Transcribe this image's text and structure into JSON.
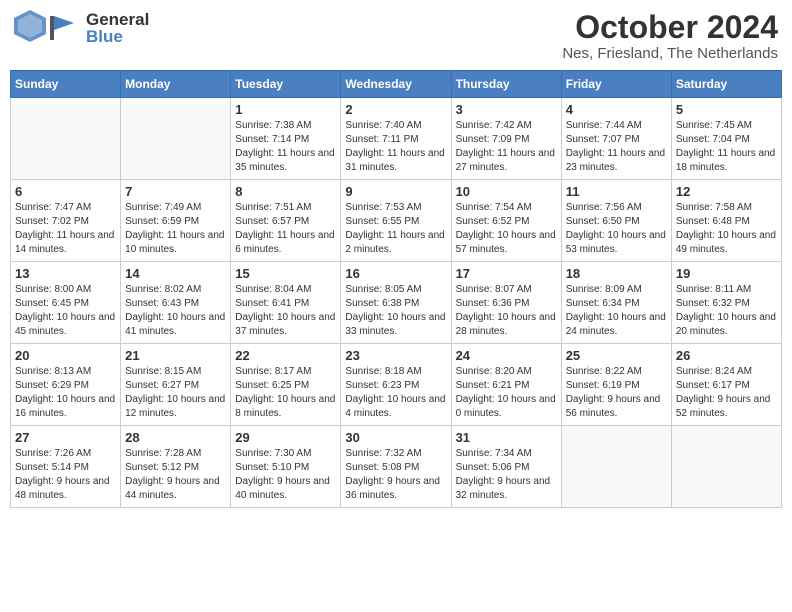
{
  "header": {
    "logo_general": "General",
    "logo_blue": "Blue",
    "month_title": "October 2024",
    "location": "Nes, Friesland, The Netherlands"
  },
  "days_of_week": [
    "Sunday",
    "Monday",
    "Tuesday",
    "Wednesday",
    "Thursday",
    "Friday",
    "Saturday"
  ],
  "weeks": [
    [
      {
        "day": "",
        "info": ""
      },
      {
        "day": "",
        "info": ""
      },
      {
        "day": "1",
        "info": "Sunrise: 7:38 AM\nSunset: 7:14 PM\nDaylight: 11 hours and 35 minutes."
      },
      {
        "day": "2",
        "info": "Sunrise: 7:40 AM\nSunset: 7:11 PM\nDaylight: 11 hours and 31 minutes."
      },
      {
        "day": "3",
        "info": "Sunrise: 7:42 AM\nSunset: 7:09 PM\nDaylight: 11 hours and 27 minutes."
      },
      {
        "day": "4",
        "info": "Sunrise: 7:44 AM\nSunset: 7:07 PM\nDaylight: 11 hours and 23 minutes."
      },
      {
        "day": "5",
        "info": "Sunrise: 7:45 AM\nSunset: 7:04 PM\nDaylight: 11 hours and 18 minutes."
      }
    ],
    [
      {
        "day": "6",
        "info": "Sunrise: 7:47 AM\nSunset: 7:02 PM\nDaylight: 11 hours and 14 minutes."
      },
      {
        "day": "7",
        "info": "Sunrise: 7:49 AM\nSunset: 6:59 PM\nDaylight: 11 hours and 10 minutes."
      },
      {
        "day": "8",
        "info": "Sunrise: 7:51 AM\nSunset: 6:57 PM\nDaylight: 11 hours and 6 minutes."
      },
      {
        "day": "9",
        "info": "Sunrise: 7:53 AM\nSunset: 6:55 PM\nDaylight: 11 hours and 2 minutes."
      },
      {
        "day": "10",
        "info": "Sunrise: 7:54 AM\nSunset: 6:52 PM\nDaylight: 10 hours and 57 minutes."
      },
      {
        "day": "11",
        "info": "Sunrise: 7:56 AM\nSunset: 6:50 PM\nDaylight: 10 hours and 53 minutes."
      },
      {
        "day": "12",
        "info": "Sunrise: 7:58 AM\nSunset: 6:48 PM\nDaylight: 10 hours and 49 minutes."
      }
    ],
    [
      {
        "day": "13",
        "info": "Sunrise: 8:00 AM\nSunset: 6:45 PM\nDaylight: 10 hours and 45 minutes."
      },
      {
        "day": "14",
        "info": "Sunrise: 8:02 AM\nSunset: 6:43 PM\nDaylight: 10 hours and 41 minutes."
      },
      {
        "day": "15",
        "info": "Sunrise: 8:04 AM\nSunset: 6:41 PM\nDaylight: 10 hours and 37 minutes."
      },
      {
        "day": "16",
        "info": "Sunrise: 8:05 AM\nSunset: 6:38 PM\nDaylight: 10 hours and 33 minutes."
      },
      {
        "day": "17",
        "info": "Sunrise: 8:07 AM\nSunset: 6:36 PM\nDaylight: 10 hours and 28 minutes."
      },
      {
        "day": "18",
        "info": "Sunrise: 8:09 AM\nSunset: 6:34 PM\nDaylight: 10 hours and 24 minutes."
      },
      {
        "day": "19",
        "info": "Sunrise: 8:11 AM\nSunset: 6:32 PM\nDaylight: 10 hours and 20 minutes."
      }
    ],
    [
      {
        "day": "20",
        "info": "Sunrise: 8:13 AM\nSunset: 6:29 PM\nDaylight: 10 hours and 16 minutes."
      },
      {
        "day": "21",
        "info": "Sunrise: 8:15 AM\nSunset: 6:27 PM\nDaylight: 10 hours and 12 minutes."
      },
      {
        "day": "22",
        "info": "Sunrise: 8:17 AM\nSunset: 6:25 PM\nDaylight: 10 hours and 8 minutes."
      },
      {
        "day": "23",
        "info": "Sunrise: 8:18 AM\nSunset: 6:23 PM\nDaylight: 10 hours and 4 minutes."
      },
      {
        "day": "24",
        "info": "Sunrise: 8:20 AM\nSunset: 6:21 PM\nDaylight: 10 hours and 0 minutes."
      },
      {
        "day": "25",
        "info": "Sunrise: 8:22 AM\nSunset: 6:19 PM\nDaylight: 9 hours and 56 minutes."
      },
      {
        "day": "26",
        "info": "Sunrise: 8:24 AM\nSunset: 6:17 PM\nDaylight: 9 hours and 52 minutes."
      }
    ],
    [
      {
        "day": "27",
        "info": "Sunrise: 7:26 AM\nSunset: 5:14 PM\nDaylight: 9 hours and 48 minutes."
      },
      {
        "day": "28",
        "info": "Sunrise: 7:28 AM\nSunset: 5:12 PM\nDaylight: 9 hours and 44 minutes."
      },
      {
        "day": "29",
        "info": "Sunrise: 7:30 AM\nSunset: 5:10 PM\nDaylight: 9 hours and 40 minutes."
      },
      {
        "day": "30",
        "info": "Sunrise: 7:32 AM\nSunset: 5:08 PM\nDaylight: 9 hours and 36 minutes."
      },
      {
        "day": "31",
        "info": "Sunrise: 7:34 AM\nSunset: 5:06 PM\nDaylight: 9 hours and 32 minutes."
      },
      {
        "day": "",
        "info": ""
      },
      {
        "day": "",
        "info": ""
      }
    ]
  ]
}
